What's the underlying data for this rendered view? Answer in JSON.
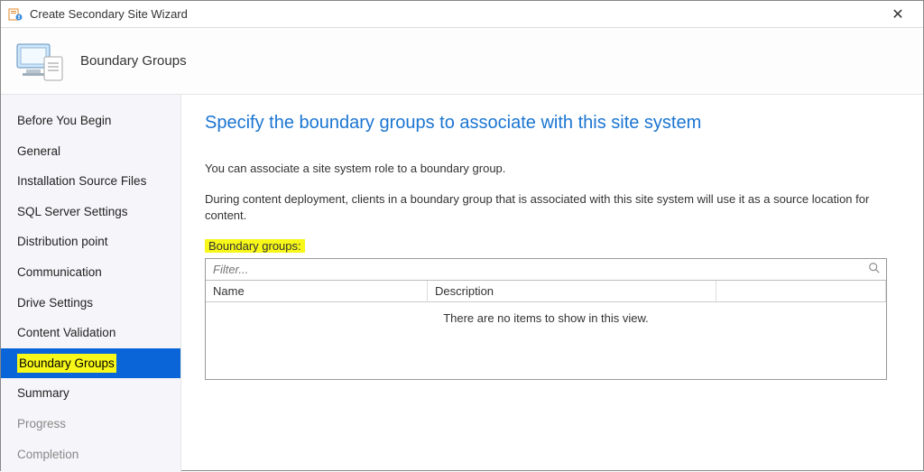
{
  "window": {
    "title": "Create Secondary Site Wizard"
  },
  "header": {
    "page_title": "Boundary Groups"
  },
  "sidebar": {
    "items": [
      {
        "label": "Before You Begin"
      },
      {
        "label": "General"
      },
      {
        "label": "Installation Source Files"
      },
      {
        "label": "SQL Server Settings"
      },
      {
        "label": "Distribution point"
      },
      {
        "label": "Communication"
      },
      {
        "label": "Drive Settings"
      },
      {
        "label": "Content Validation"
      },
      {
        "label": "Boundary Groups"
      },
      {
        "label": "Summary"
      },
      {
        "label": "Progress"
      },
      {
        "label": "Completion"
      }
    ]
  },
  "main": {
    "heading": "Specify the boundary groups to associate with this site system",
    "para1": "You can associate a site system role to a boundary group.",
    "para2": "During content deployment, clients in a boundary group that is associated with this site system will use it as a source location for content.",
    "section_label": "Boundary groups:",
    "filter_placeholder": "Filter...",
    "columns": {
      "name": "Name",
      "description": "Description"
    },
    "empty": "There are no items to show in this view."
  }
}
